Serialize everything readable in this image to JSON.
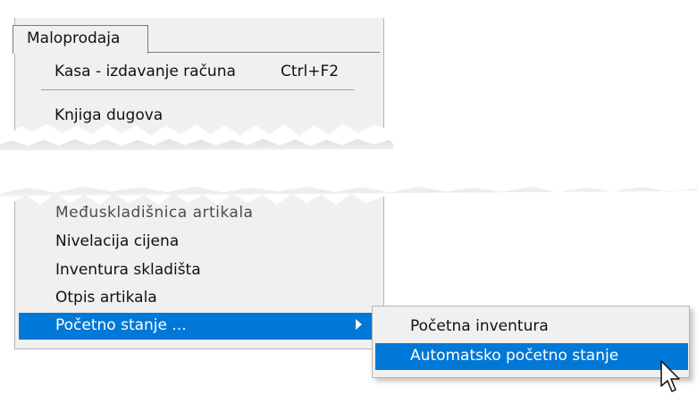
{
  "menu_header": {
    "label": "Maloprodaja"
  },
  "top_menu": {
    "items": [
      {
        "label": "Kasa - izdavanje računa",
        "shortcut": "Ctrl+F2"
      },
      {
        "label": "Knjiga dugova"
      }
    ]
  },
  "bottom_menu": {
    "items": [
      {
        "label": "Međuskladišnica artikala",
        "state": "partially-visible"
      },
      {
        "label": "Nivelacija cijena"
      },
      {
        "label": "Inventura skladišta"
      },
      {
        "label": "Otpis artikala"
      },
      {
        "label": "Početno stanje ...",
        "state": "highlighted",
        "has_submenu": true
      }
    ]
  },
  "submenu": {
    "items": [
      {
        "label": "Početna inventura"
      },
      {
        "label": "Automatsko početno stanje",
        "state": "highlighted"
      }
    ]
  },
  "icons": [
    "submenu-arrow-icon",
    "mouse-pointer-icon"
  ],
  "colors": {
    "menu_background": "#f0f0f0",
    "highlight": "#0078d7",
    "highlight_text": "#ffffff"
  }
}
